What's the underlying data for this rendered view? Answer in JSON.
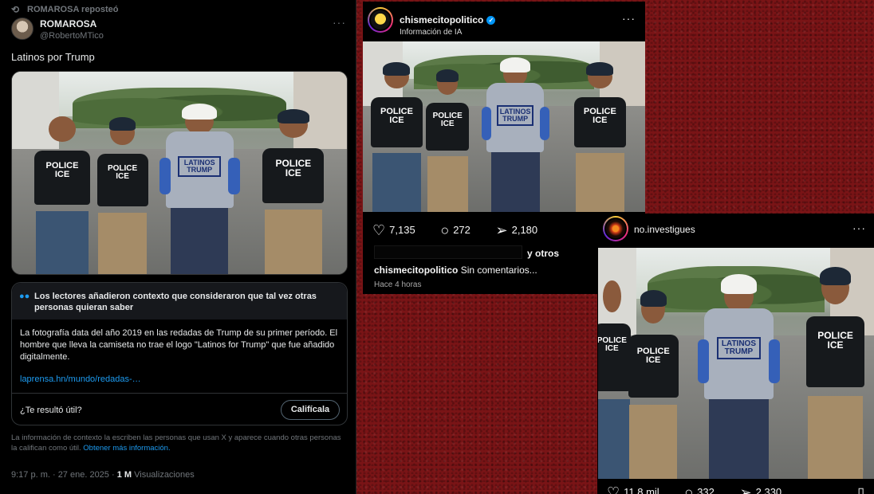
{
  "tweet": {
    "repost_label": "ROMAROSA reposteó",
    "author_name": "ROMAROSA",
    "author_handle": "@RobertoMTico",
    "text": "Latinos por Trump",
    "note": {
      "header": "Los lectores añadieron contexto que consideraron que tal vez otras personas quieran saber",
      "body": "La fotografía data del año 2019 en las redadas de Trump de su primer período. El hombre que lleva la camiseta no trae el logo \"Latinos for Trump\" que fue añadido digitalmente.",
      "link": "laprensa.hn/mundo/redadas-…",
      "question": "¿Te resultó útil?",
      "rate_button": "Califícala"
    },
    "footnote": "La información de contexto la escriben las personas que usan X y aparece cuando otras personas la califican como útil.",
    "footnote_link": "Obtener más información.",
    "timestamp": "9:17 p. m. · 27 ene. 2025 ·",
    "views_count": "1 M",
    "views_label": "Visualizaciones"
  },
  "photo": {
    "vest_text_1": "POLICE",
    "vest_text_2": "ICE",
    "shirt_text_1": "LATINOS",
    "shirt_text_2": "TRUMP"
  },
  "ig_post_1": {
    "username": "chismecitopolitico",
    "subtitle": "Información de IA",
    "likes": "7,135",
    "comments": "272",
    "shares": "2,180",
    "others_label": "y otros",
    "caption_user": "chismecitopolitico",
    "caption_text": "Sin comentarios...",
    "time": "Hace 4 horas"
  },
  "ig_post_2": {
    "username": "no.investigues",
    "likes": "11,8 mil",
    "comments": "332",
    "shares": "2,330"
  },
  "colors": {
    "background": "#7a1416",
    "x_link": "#1d9bf0",
    "ig_verified": "#0095f6"
  }
}
